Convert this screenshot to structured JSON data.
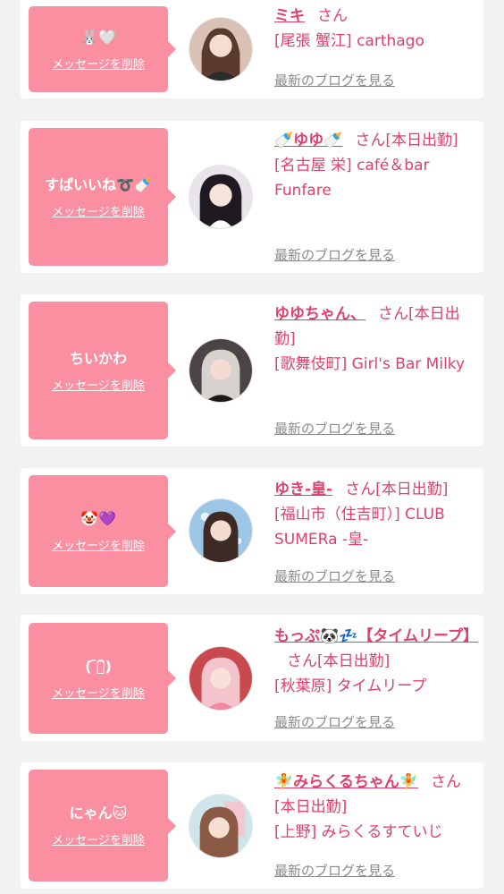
{
  "colors": {
    "page_bg": "#f2f2f2",
    "card_bg": "#ffffff",
    "bubble_bg": "#fb8fa2",
    "accent": "#e0406a",
    "muted": "#8a8a8a"
  },
  "entries": [
    {
      "message": "🐰🤍",
      "delete_label": "メッセージを削除",
      "name": "ミキ",
      "suffix": "さん",
      "shop": "[尾張 蟹江] carthago",
      "blog_link": "最新のブログを見る",
      "avatar": "profile-photo"
    },
    {
      "message": "すぱいいね➰🍼",
      "delete_label": "メッセージを削除",
      "name": "🍼ゆゆ🍼",
      "suffix": "さん[本日出勤]",
      "shop": "[名古屋 栄] café＆bar Funfare",
      "blog_link": "最新のブログを見る",
      "avatar": "profile-photo"
    },
    {
      "message": "ちいかわ",
      "delete_label": "メッセージを削除",
      "name": "ゆゆちゃん、",
      "suffix": "さん[本日出勤]",
      "shop": "[歌舞伎町] Girl's Bar Milky",
      "blog_link": "最新のブログを見る",
      "avatar": "profile-photo"
    },
    {
      "message": "🤡💜",
      "delete_label": "メッセージを削除",
      "name": "ゆき-皇-",
      "suffix": "さん[本日出勤]",
      "shop": "[福山市（住吉町）] CLUB SUMERa -皇-",
      "blog_link": "最新のブログを見る",
      "avatar": "profile-photo"
    },
    {
      "message": "( ᷇࿀᷆)",
      "delete_label": "メッセージを削除",
      "name": "もっぷ🐼💤【タイムリープ】",
      "suffix": "さん[本日出勤]",
      "shop": "[秋葉原] タイムリープ",
      "blog_link": "最新のブログを見る",
      "avatar": "profile-photo"
    },
    {
      "message": "にゃん🐱",
      "delete_label": "メッセージを削除",
      "name": "🧚みらくるちゃん🧚",
      "suffix": "さん[本日出勤]",
      "shop": "[上野] みらくるすていじ",
      "blog_link": "最新のブログを見る",
      "avatar": "profile-photo"
    }
  ]
}
